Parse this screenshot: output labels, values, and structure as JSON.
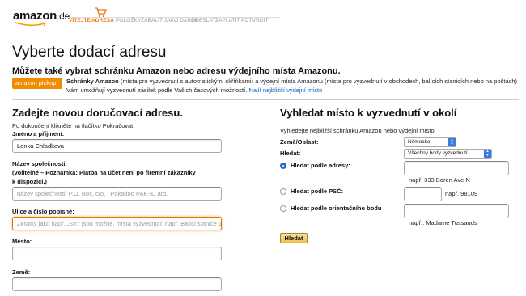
{
  "header": {
    "logo_text": "amazon",
    "logo_tld": ".de",
    "steps": [
      {
        "label": "VÍTEJTE",
        "active": true
      },
      {
        "label": "ADRESA",
        "active": true
      },
      {
        "label": "POLOŽKY",
        "active": false
      },
      {
        "label": "ZABALIT JAKO DÁREK",
        "active": false
      },
      {
        "label": "ODESLAT",
        "active": false
      },
      {
        "label": "ZAPLATIT",
        "active": false
      },
      {
        "label": "POTVRDIT",
        "active": false
      }
    ],
    "accent_color": "#e47911"
  },
  "page_title": "Vyberte dodací adresu",
  "pickup_info": {
    "title": "Můžete také vybrat schránku Amazon nebo adresu výdejního místa Amazonu.",
    "badge": "amazon pickup",
    "text_bold": "Schránky Amazon",
    "text": " (místa pro vyzvednutí s automatickými skříňkami) a výdejní místa Amazonu (místa pro vyzvednutí v obchodech, balících stanicích nebo na poštách) Vám umožňují vyzvednutí zásilek podle Vašich časových možností.",
    "link": "Najít nejbližší výdejní místo"
  },
  "new_address": {
    "heading": "Zadejte novou doručovací adresu.",
    "instruction": "Po dokončení klikněte na tlačítko Pokračovat.",
    "name_label": "Jméno a příjmení:",
    "name_value": "Lenka Chladkova",
    "company_label_1": "Název společnosti:",
    "company_label_2": "(volitelné – Poznámka: Platba na účet není po firemní zákazníky",
    "company_label_3": "k dispozici.)",
    "company_placeholder": "název společnosti, P.O. Box, c/o, , Pakadoo PAK-ID atd.",
    "street_label": "Ulice a číslo popisné:",
    "street_placeholder": "Zkratky jako např. „Str.“ jsou možné.  místa vyzvednutí: např. Balící stanice 10",
    "city_label": "Město:",
    "city_value": "",
    "country_label": "Země:",
    "country_value": ""
  },
  "pickup_search": {
    "heading": "Vyhledat místo k vyzvednutí v okolí",
    "instruction": "Vyhledejte nejbližší schránku Amazon nebo výdejní místo.",
    "country_label": "Země/Oblast:",
    "country_selected": "Německo",
    "search_label": "Hledat:",
    "search_selected": "Všechny body vyzvednutí",
    "options": [
      {
        "label": "Hledat podle adresy:",
        "hint": "např. 333 Boren Ave N",
        "checked": true
      },
      {
        "label": "Hledat podle PSČ:",
        "hint": "např. 98109",
        "checked": false
      },
      {
        "label": "Hledat podle orientačního bodu",
        "hint": "např.: Madame Tussauds",
        "checked": false
      }
    ],
    "button_label": "Hledat"
  }
}
